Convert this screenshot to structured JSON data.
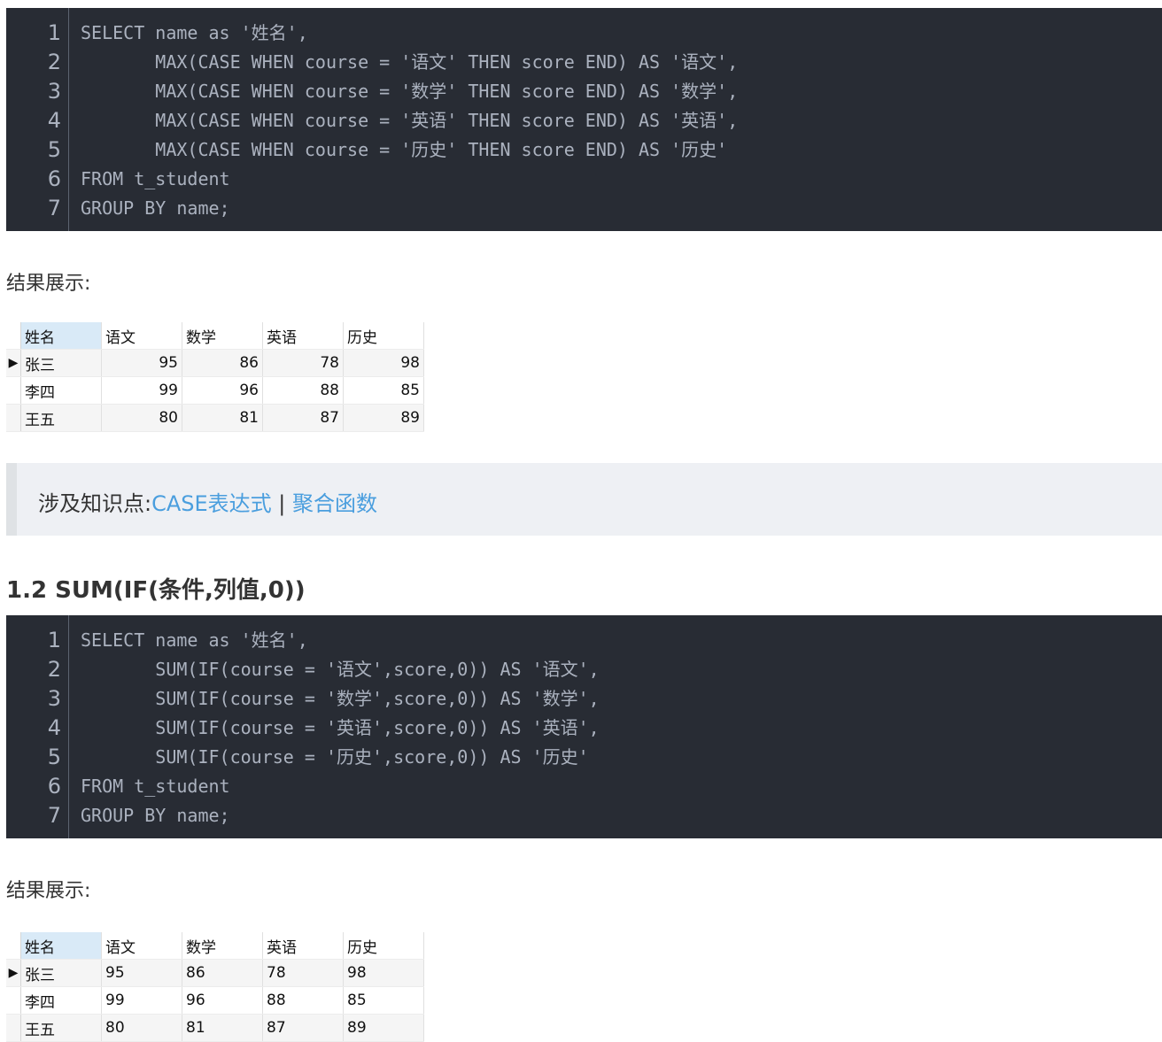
{
  "code_block_1": {
    "line_numbers": [
      "1",
      "2",
      "3",
      "4",
      "5",
      "6",
      "7"
    ],
    "lines": [
      "SELECT name as '姓名',",
      "       MAX(CASE WHEN course = '语文' THEN score END) AS '语文',",
      "       MAX(CASE WHEN course = '数学' THEN score END) AS '数学',",
      "       MAX(CASE WHEN course = '英语' THEN score END) AS '英语',",
      "       MAX(CASE WHEN course = '历史' THEN score END) AS '历史'",
      "FROM t_student",
      "GROUP BY name;"
    ]
  },
  "result_label_1": "结果展示:",
  "table_1": {
    "row_marker": "▶",
    "headers": [
      "姓名",
      "语文",
      "数学",
      "英语",
      "历史"
    ],
    "rows": [
      [
        "张三",
        "95",
        "86",
        "78",
        "98"
      ],
      [
        "李四",
        "99",
        "96",
        "88",
        "85"
      ],
      [
        "王五",
        "80",
        "81",
        "87",
        "89"
      ]
    ]
  },
  "note": {
    "prefix": "涉及知识点:",
    "link1": "CASE表达式",
    "separator": " | ",
    "link2": "聚合函数"
  },
  "section_heading": "1.2 SUM(IF(条件,列值,0))",
  "code_block_2": {
    "line_numbers": [
      "1",
      "2",
      "3",
      "4",
      "5",
      "6",
      "7"
    ],
    "lines": [
      "SELECT name as '姓名',",
      "       SUM(IF(course = '语文',score,0)) AS '语文',",
      "       SUM(IF(course = '数学',score,0)) AS '数学',",
      "       SUM(IF(course = '英语',score,0)) AS '英语',",
      "       SUM(IF(course = '历史',score,0)) AS '历史'",
      "FROM t_student",
      "GROUP BY name;"
    ]
  },
  "result_label_2": "结果展示:",
  "table_2": {
    "row_marker": "▶",
    "headers": [
      "姓名",
      "语文",
      "数学",
      "英语",
      "历史"
    ],
    "rows": [
      [
        "张三",
        "95",
        "86",
        "78",
        "98"
      ],
      [
        "李四",
        "99",
        "96",
        "88",
        "85"
      ],
      [
        "王五",
        "80",
        "81",
        "87",
        "89"
      ]
    ]
  }
}
